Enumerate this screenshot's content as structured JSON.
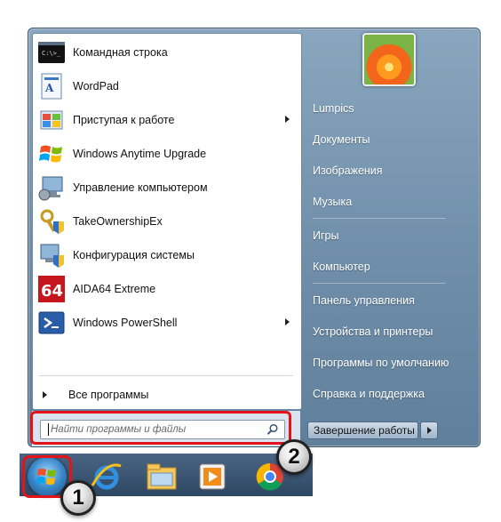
{
  "programs": [
    {
      "label": "Командная строка",
      "icon": "cmd-icon",
      "has_submenu": false
    },
    {
      "label": "WordPad",
      "icon": "wordpad-icon",
      "has_submenu": false
    },
    {
      "label": "Приступая к работе",
      "icon": "getting-started-icon",
      "has_submenu": true
    },
    {
      "label": "Windows Anytime Upgrade",
      "icon": "windows-flag-icon",
      "has_submenu": false
    },
    {
      "label": "Управление компьютером",
      "icon": "computer-management-icon",
      "has_submenu": false
    },
    {
      "label": "TakeOwnershipEx",
      "icon": "takeownership-icon",
      "has_submenu": false
    },
    {
      "label": "Конфигурация системы",
      "icon": "system-config-icon",
      "has_submenu": false
    },
    {
      "label": "AIDA64 Extreme",
      "icon": "aida64-icon",
      "has_submenu": false
    },
    {
      "label": "Windows PowerShell",
      "icon": "powershell-icon",
      "has_submenu": true
    }
  ],
  "all_programs_label": "Все программы",
  "search": {
    "placeholder": "Найти программы и файлы"
  },
  "right_panel": {
    "items": [
      "Lumpics",
      "Документы",
      "Изображения",
      "Музыка",
      "Игры",
      "Компьютер",
      "Панель управления",
      "Устройства и принтеры",
      "Программы по умолчанию",
      "Справка и поддержка"
    ]
  },
  "shutdown_label": "Завершение работы",
  "taskbar": {
    "icons": [
      "start-orb-icon",
      "internet-explorer-icon",
      "file-explorer-icon",
      "media-player-icon",
      "chrome-icon"
    ]
  },
  "badges": {
    "one": "1",
    "two": "2"
  },
  "colors": {
    "highlight": "#e2141a",
    "menu_blue": "#6f8ea9"
  }
}
